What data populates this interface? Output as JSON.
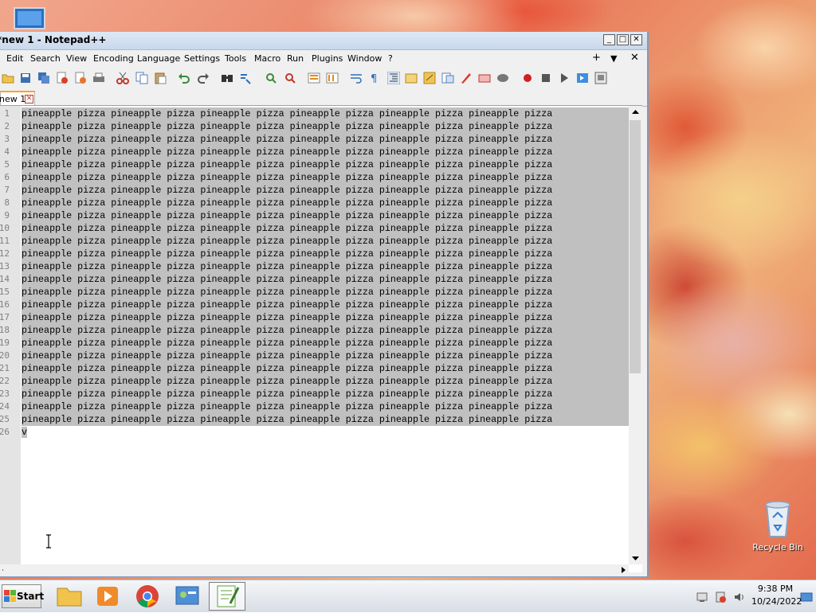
{
  "window": {
    "title": "*new 1 - Notepad++",
    "min_glyph": "_",
    "max_glyph": "□",
    "close_glyph": "✕"
  },
  "menu": {
    "items": [
      "Edit",
      "Search",
      "View",
      "Encoding",
      "Language",
      "Settings",
      "Tools",
      "Macro",
      "Run",
      "Plugins",
      "Window",
      "?"
    ],
    "plus": "+",
    "down": "▼",
    "close": "✕"
  },
  "tab": {
    "name": "new 1",
    "close_glyph": "✕"
  },
  "editor": {
    "line_numbers": [
      "1",
      "2",
      "3",
      "4",
      "5",
      "6",
      "7",
      "8",
      "9",
      "10",
      "11",
      "12",
      "13",
      "14",
      "15",
      "16",
      "17",
      "18",
      "19",
      "20",
      "21",
      "22",
      "23",
      "24",
      "25",
      "26"
    ],
    "line_text": "pineapple pizza pineapple pizza pineapple pizza pineapple pizza pineapple pizza pineapple pizza",
    "last_line_text": "v"
  },
  "taskbar": {
    "start_label": "Start",
    "time": "9:38 PM",
    "date": "10/24/2022"
  },
  "desktop": {
    "recycle_bin_label": "Recycle Bin"
  },
  "colors": {
    "selection": "#c0c0c0",
    "gutter": "#e4e4e4",
    "tab_accent": "#f5a623"
  }
}
